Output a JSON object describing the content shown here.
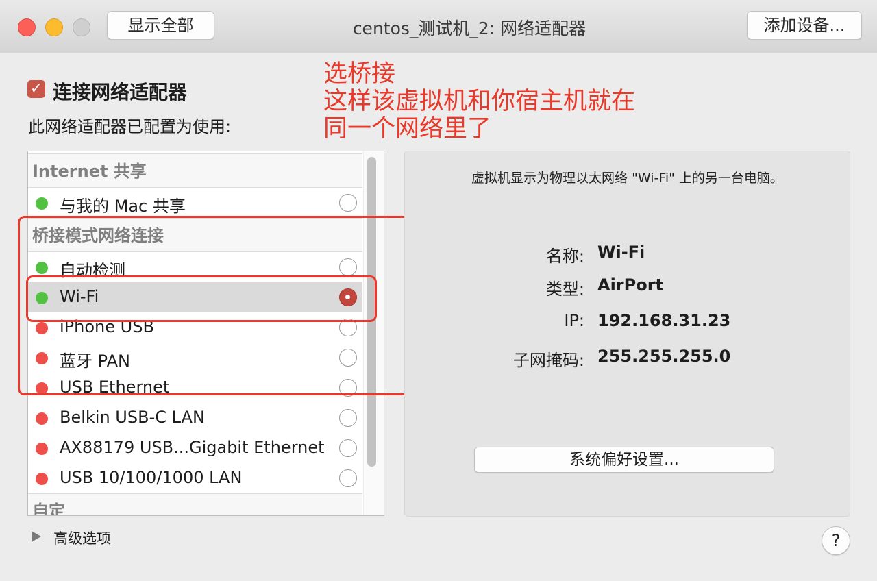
{
  "window": {
    "title": "centos_测试机_2: 网络适配器",
    "show_all_button": "显示全部",
    "add_device_button": "添加设备..."
  },
  "header": {
    "connect_checkbox_label": "连接网络适配器",
    "connect_checked": true,
    "configured_label": "此网络适配器已配置为使用:"
  },
  "annotation": {
    "text": "选桥接\n这样该虚拟机和你宿主机就在\n同一个网络里了",
    "color": "#e8392a"
  },
  "network_list": {
    "groups": [
      {
        "header": "Internet 共享",
        "items": [
          {
            "label": "与我的 Mac 共享",
            "status": "green",
            "selected": false
          }
        ]
      },
      {
        "header": "桥接模式网络连接",
        "items": [
          {
            "label": "自动检测",
            "status": "green",
            "selected": false
          },
          {
            "label": "Wi-Fi",
            "status": "green",
            "selected": true
          },
          {
            "label": "iPhone USB",
            "status": "red",
            "selected": false
          },
          {
            "label": "蓝牙 PAN",
            "status": "red",
            "selected": false
          },
          {
            "label": "USB Ethernet",
            "status": "red",
            "selected": false
          },
          {
            "label": "Belkin USB-C LAN",
            "status": "red",
            "selected": false
          },
          {
            "label": "AX88179 USB...Gigabit Ethernet",
            "status": "red",
            "selected": false
          },
          {
            "label": "USB 10/100/1000 LAN",
            "status": "red",
            "selected": false
          }
        ]
      },
      {
        "header": "自定",
        "items": []
      }
    ]
  },
  "detail": {
    "description": "虚拟机显示为物理以太网络 \"Wi-Fi\" 上的另一台电脑。",
    "fields": [
      {
        "key": "名称:",
        "value": "Wi-Fi"
      },
      {
        "key": "类型:",
        "value": "AirPort"
      },
      {
        "key": "IP:",
        "value": "192.168.31.23"
      },
      {
        "key": "子网掩码:",
        "value": "255.255.255.0"
      }
    ],
    "prefs_button": "系统偏好设置..."
  },
  "footer": {
    "advanced_label": "高级选项",
    "help_label": "?"
  }
}
